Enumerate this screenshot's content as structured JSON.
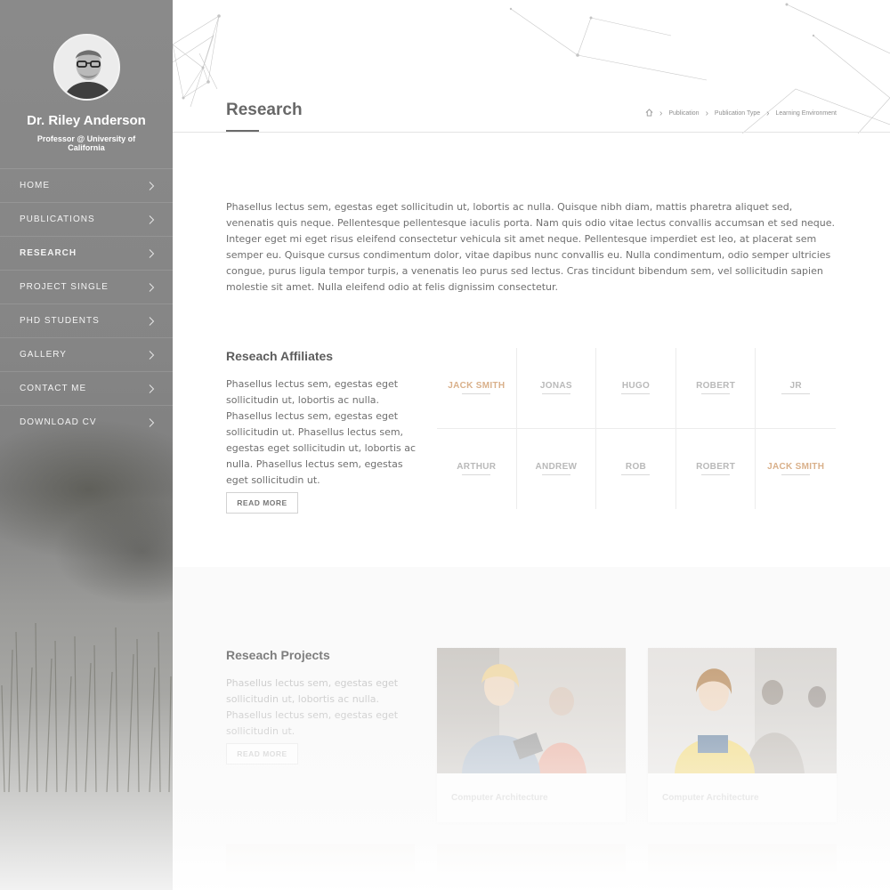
{
  "sidebar": {
    "name": "Dr. Riley Anderson",
    "role": "Professor @ University of California",
    "nav": [
      {
        "label": "HOME",
        "active": false
      },
      {
        "label": "PUBLICATIONS",
        "active": false
      },
      {
        "label": "RESEARCH",
        "active": true
      },
      {
        "label": "PROJECT SINGLE",
        "active": false
      },
      {
        "label": "PHD STUDENTS",
        "active": false
      },
      {
        "label": "GALLERY",
        "active": false
      },
      {
        "label": "CONTACT ME",
        "active": false
      },
      {
        "label": "DOWNLOAD CV",
        "active": false
      }
    ]
  },
  "header": {
    "title": "Research",
    "breadcrumb": [
      "Publication",
      "Publication Type",
      "Learning Environment"
    ]
  },
  "intro": "Phasellus lectus sem, egestas eget sollicitudin ut, lobortis ac nulla. Quisque nibh diam, mattis pharetra aliquet sed, venenatis quis neque. Pellentesque pellentesque iaculis porta. Nam quis odio vitae lectus convallis accumsan et sed neque. Integer eget mi eget risus eleifend consectetur vehicula sit amet neque. Pellentesque imperdiet est leo, at placerat sem semper eu. Quisque cursus condimentum dolor, vitae dapibus nunc convallis eu. Nulla condimentum, odio semper ultricies congue, purus ligula tempor turpis, a venenatis leo purus sed lectus. Cras tincidunt bibendum sem, vel sollicitudin sapien molestie sit amet. Nulla eleifend odio at felis dignissim consectetur.",
  "affiliates": {
    "title": "Reseach Affiliates",
    "text": "Phasellus lectus sem, egestas eget sollicitudin ut, lobortis ac nulla. Phasellus lectus sem, egestas eget sollicitudin ut. Phasellus lectus sem, egestas eget sollicitudin ut, lobortis ac nulla. Phasellus lectus sem, egestas eget sollicitudin ut.",
    "button": "READ MORE",
    "logos": [
      {
        "top": "",
        "main": "JACK SMITH",
        "sub": "",
        "orange": true
      },
      {
        "top": "",
        "main": "JONAS",
        "sub": "",
        "orange": false
      },
      {
        "top": "",
        "main": "HUGO",
        "sub": "",
        "orange": false
      },
      {
        "top": "",
        "main": "ROBERT",
        "sub": "",
        "orange": false
      },
      {
        "top": "",
        "main": "JR",
        "sub": "",
        "orange": false
      },
      {
        "top": "",
        "main": "ARTHUR",
        "sub": "",
        "orange": false
      },
      {
        "top": "",
        "main": "ANDREW",
        "sub": "",
        "orange": false
      },
      {
        "top": "",
        "main": "ROB",
        "sub": "",
        "orange": false
      },
      {
        "top": "",
        "main": "ROBERT",
        "sub": "",
        "orange": false
      },
      {
        "top": "",
        "main": "JACK SMITH",
        "sub": "",
        "orange": true
      }
    ]
  },
  "projects": {
    "title": "Reseach Projects",
    "text": "Phasellus lectus sem, egestas eget sollicitudin ut, lobortis ac nulla. Phasellus lectus sem, egestas eget sollicitudin ut.",
    "button": "READ MORE",
    "cards": [
      {
        "label": "Computer Architecture"
      },
      {
        "label": "Computer Architecture"
      }
    ]
  },
  "colors": {
    "sidebar": "#858585",
    "accent_logo": "#d9b08a",
    "text": "#6f6f6f"
  }
}
